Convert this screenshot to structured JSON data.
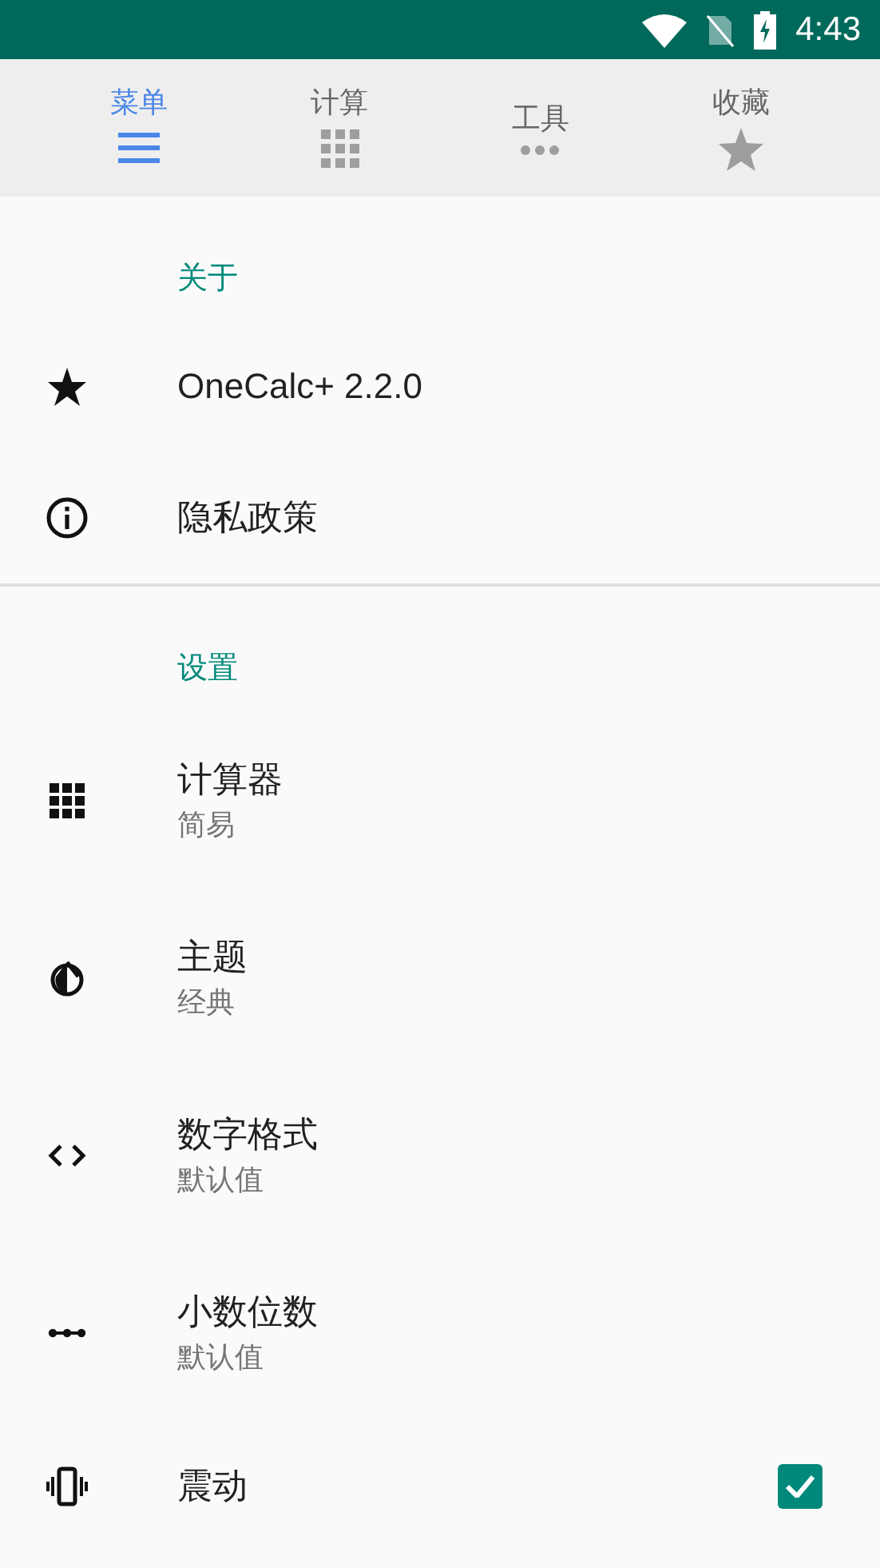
{
  "status_bar": {
    "time": "4:43"
  },
  "tabs": [
    {
      "label": "菜单",
      "selected": true
    },
    {
      "label": "计算",
      "selected": false
    },
    {
      "label": "工具",
      "selected": false
    },
    {
      "label": "收藏",
      "selected": false
    }
  ],
  "sections": [
    {
      "header": "关于",
      "items": [
        {
          "kind": "plain",
          "title": "OneCalc+ 2.2.0"
        },
        {
          "kind": "plain",
          "title": "隐私政策"
        }
      ]
    },
    {
      "header": "设置",
      "items": [
        {
          "kind": "plain",
          "title": "计算器",
          "subtitle": "简易"
        },
        {
          "kind": "plain",
          "title": "主题",
          "subtitle": "经典"
        },
        {
          "kind": "plain",
          "title": "数字格式",
          "subtitle": "默认值"
        },
        {
          "kind": "plain",
          "title": "小数位数",
          "subtitle": "默认值"
        },
        {
          "kind": "checkbox",
          "title": "震动",
          "checked": true
        }
      ]
    }
  ]
}
